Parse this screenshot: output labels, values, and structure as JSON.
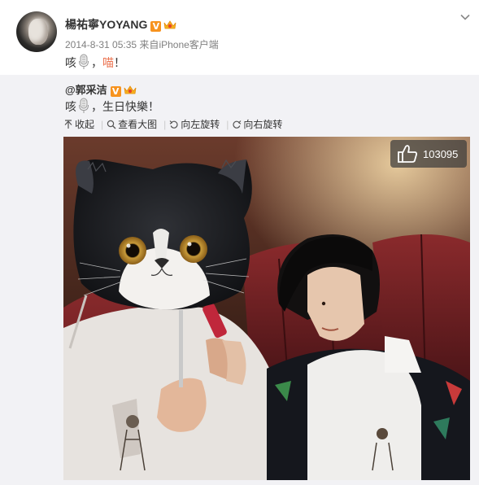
{
  "post": {
    "username": "楊祐寧YOYANG",
    "verified_badge": "V",
    "meta_time": "2014-8-31 05:35",
    "meta_from": "来自",
    "meta_source": "iPhone客户端",
    "text_prefix": "咳",
    "text_sep": "，",
    "text_meow": "喵",
    "text_end": "！"
  },
  "repost": {
    "username": "@郭采洁",
    "verified_badge": "V",
    "text_prefix": "咳",
    "text_rest": "，生日快樂！"
  },
  "toolbar": {
    "collapse": "收起",
    "view_large": "查看大图",
    "rotate_left": "向左旋转",
    "rotate_right": "向右旋转"
  },
  "photo": {
    "like_count": "103095"
  },
  "colors": {
    "accent_orange": "#f7931e",
    "highlight": "#eb7350",
    "repost_bg": "#f2f2f5",
    "meta_text": "#808080"
  },
  "icons": [
    "microphone-icon",
    "crown-icon",
    "chevron-down-icon",
    "collapse-icon",
    "magnifier-icon",
    "rotate-left-icon",
    "rotate-right-icon",
    "thumbs-up-icon"
  ]
}
